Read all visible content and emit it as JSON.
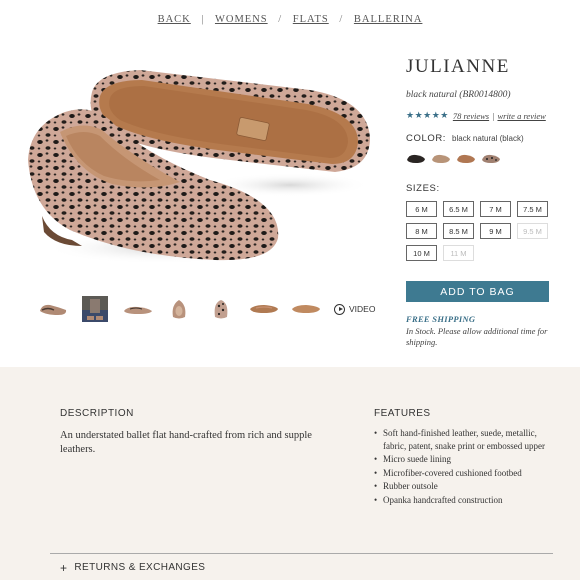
{
  "breadcrumb": {
    "back": "BACK",
    "sep1": "|",
    "womens": "WOMENS",
    "sep2": "/",
    "flats": "FLATS",
    "sep3": "/",
    "ballerina": "BALLERINA"
  },
  "product": {
    "name": "JULIANNE",
    "sku": "black natural (BR0014800)",
    "rating": {
      "stars": "★★★★★",
      "reviews_link": "78 reviews",
      "separator": "|",
      "write_link": "write a review"
    },
    "color_label": "COLOR:",
    "color_value": "black natural (black)",
    "swatches": [
      {
        "name": "black",
        "color": "#2a2523"
      },
      {
        "name": "tan",
        "color": "#b89478"
      },
      {
        "name": "cognac",
        "color": "#b07752"
      },
      {
        "name": "black natural",
        "color": "#a08070"
      }
    ],
    "sizes_label": "SIZES:",
    "sizes": [
      {
        "label": "6 M",
        "available": true
      },
      {
        "label": "6.5 M",
        "available": true
      },
      {
        "label": "7 M",
        "available": true
      },
      {
        "label": "7.5 M",
        "available": true
      },
      {
        "label": "8 M",
        "available": true
      },
      {
        "label": "8.5 M",
        "available": true
      },
      {
        "label": "9 M",
        "available": true
      },
      {
        "label": "9.5 M",
        "available": false
      },
      {
        "label": "10 M",
        "available": true
      },
      {
        "label": "11 M",
        "available": false
      }
    ],
    "add_to_bag": "ADD TO BAG",
    "free_shipping": "FREE SHIPPING",
    "stock_note": "In Stock. Please allow additional time for shipping."
  },
  "gallery": {
    "video_label": "VIDEO"
  },
  "details": {
    "description_heading": "DESCRIPTION",
    "description_text": "An understated ballet flat hand-crafted from rich and supple leathers.",
    "features_heading": "FEATURES",
    "features": [
      "Soft hand-finished leather, suede, metallic, fabric, patent, snake print or embossed upper",
      "Micro suede lining",
      "Microfiber-covered cushioned footbed",
      "Rubber outsole",
      "Opanka handcrafted construction"
    ],
    "returns_label": "RETURNS & EXCHANGES"
  },
  "colors": {
    "accent": "#3e7a91",
    "panel_bg": "#f6f2ed"
  }
}
